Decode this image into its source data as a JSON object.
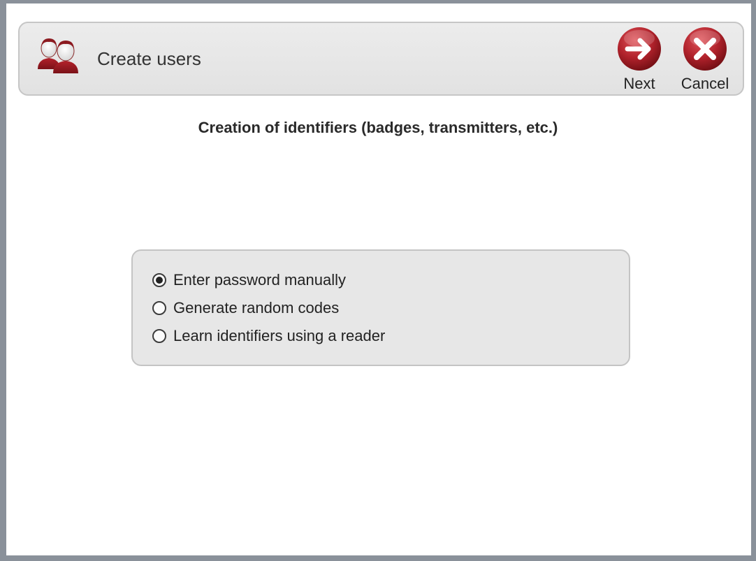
{
  "toolbar": {
    "icon": "users-icon",
    "title": "Create users",
    "next_label": "Next",
    "next_icon": "arrow-right-icon",
    "cancel_label": "Cancel",
    "cancel_icon": "close-icon",
    "button_color": "#b0222b"
  },
  "main": {
    "heading": "Creation of identifiers (badges, transmitters, etc.)",
    "options": [
      {
        "label": "Enter password manually",
        "selected": true
      },
      {
        "label": "Generate random codes",
        "selected": false
      },
      {
        "label": "Learn identifiers using a reader",
        "selected": false
      }
    ]
  }
}
